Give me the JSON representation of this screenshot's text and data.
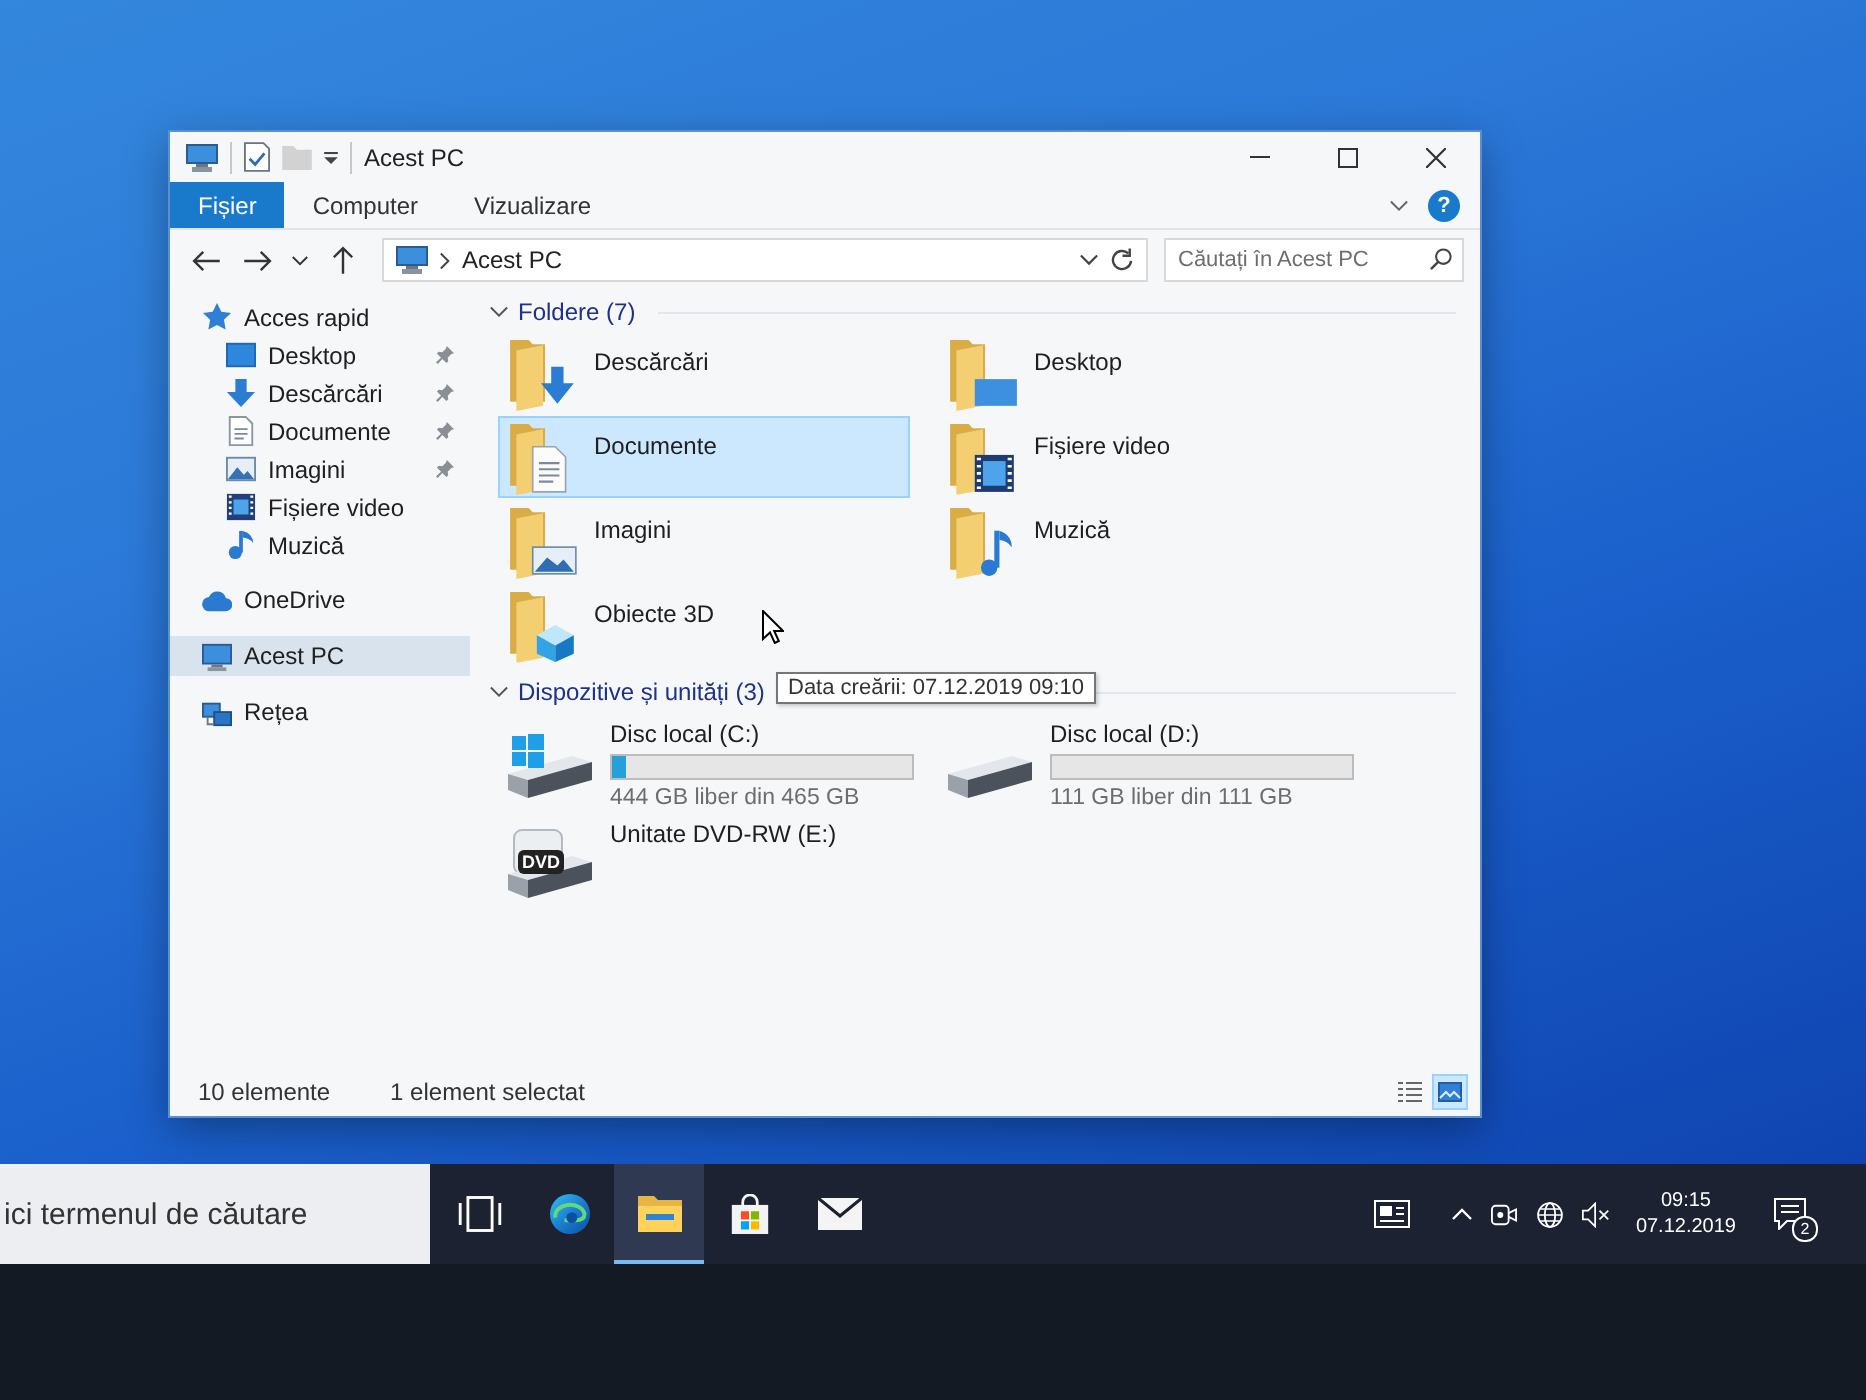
{
  "window": {
    "title": "Acest PC"
  },
  "ribbon": {
    "tabs": [
      {
        "label": "Fișier",
        "kind": "file"
      },
      {
        "label": "Computer",
        "kind": "tab"
      },
      {
        "label": "Vizualizare",
        "kind": "tab"
      }
    ],
    "help": "?"
  },
  "address_bar": {
    "path": [
      "Acest PC"
    ]
  },
  "search": {
    "placeholder": "Căutați în Acest PC"
  },
  "sidebar": {
    "items": [
      {
        "label": "Acces rapid",
        "kind": "quick",
        "selected": false,
        "children": [
          {
            "label": "Desktop",
            "kind": "desktop",
            "pinned": true,
            "selected": false
          },
          {
            "label": "Descărcări",
            "kind": "downloads",
            "pinned": true,
            "selected": false
          },
          {
            "label": "Documente",
            "kind": "documents",
            "pinned": true,
            "selected": false
          },
          {
            "label": "Imagini",
            "kind": "pictures",
            "pinned": true,
            "selected": false
          },
          {
            "label": "Fișiere video",
            "kind": "videos",
            "pinned": false,
            "selected": false
          },
          {
            "label": "Muzică",
            "kind": "music",
            "pinned": false,
            "selected": false
          }
        ]
      },
      {
        "label": "OneDrive",
        "kind": "cloud",
        "selected": false
      },
      {
        "label": "Acest PC",
        "kind": "computer",
        "selected": true
      },
      {
        "label": "Rețea",
        "kind": "network",
        "selected": false
      }
    ]
  },
  "folders": {
    "title": "Foldere (7)",
    "expanded": true,
    "items": [
      {
        "name": "Descărcări",
        "kind": "downloads",
        "selected": false
      },
      {
        "name": "Desktop",
        "kind": "desktop",
        "selected": false
      },
      {
        "name": "Documente",
        "kind": "documents",
        "selected": true
      },
      {
        "name": "Fișiere video",
        "kind": "videos",
        "selected": false
      },
      {
        "name": "Imagini",
        "kind": "pictures",
        "selected": false
      },
      {
        "name": "Muzică",
        "kind": "music",
        "selected": false
      },
      {
        "name": "Obiecte 3D",
        "kind": "objects3d",
        "selected": false
      }
    ]
  },
  "devices": {
    "title": "Dispozitive și unități (3)",
    "expanded": true,
    "items": [
      {
        "name": "Disc local (C:)",
        "kind": "system",
        "level": 0.045,
        "reading": "444 GB liber din 465 GB"
      },
      {
        "name": "Disc local (D:)",
        "kind": "disk",
        "reading": "111 GB liber din 111 GB"
      },
      {
        "name": "Unitate DVD-RW (E:)",
        "kind": "dvd",
        "badge": "DVD"
      }
    ]
  },
  "tooltip": {
    "text": "Data creării: 07.12.2019 09:10"
  },
  "status_bar": {
    "count": "10 elemente",
    "selection": "1 element selectat",
    "views": [
      {
        "kind": "details",
        "selected": false
      },
      {
        "kind": "tiles",
        "selected": true
      }
    ]
  },
  "taskbar": {
    "search": {
      "placeholder": "ici termenul de căutare"
    },
    "apps": [
      {
        "kind": "taskview",
        "active": false
      },
      {
        "kind": "browser",
        "active": false
      },
      {
        "kind": "files",
        "active": true
      },
      {
        "kind": "store",
        "active": false
      },
      {
        "kind": "mail",
        "active": false
      }
    ],
    "tray": {
      "muted": true,
      "time": "09:15",
      "date": "07.12.2019",
      "notifications": "2"
    }
  }
}
